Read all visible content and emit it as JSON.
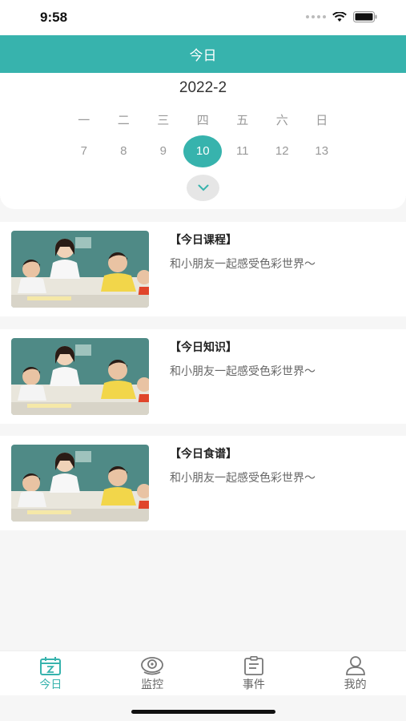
{
  "status_bar": {
    "time": "9:58"
  },
  "nav": {
    "title": "今日"
  },
  "calendar": {
    "month_title": "2022-2",
    "weekdays": [
      "一",
      "二",
      "三",
      "四",
      "五",
      "六",
      "日"
    ],
    "dates": [
      "7",
      "8",
      "9",
      "10",
      "11",
      "12",
      "13"
    ],
    "selected_date": "10"
  },
  "cards": [
    {
      "title": "【今日课程】",
      "desc": "和小朋友一起感受色彩世界～"
    },
    {
      "title": "【今日知识】",
      "desc": "和小朋友一起感受色彩世界～"
    },
    {
      "title": "【今日食谱】",
      "desc": "和小朋友一起感受色彩世界～"
    }
  ],
  "tabbar": {
    "items": [
      {
        "label": "今日",
        "icon": "calendar-icon",
        "active": true
      },
      {
        "label": "监控",
        "icon": "camera-icon",
        "active": false
      },
      {
        "label": "事件",
        "icon": "clipboard-icon",
        "active": false
      },
      {
        "label": "我的",
        "icon": "user-icon",
        "active": false
      }
    ]
  },
  "colors": {
    "accent": "#37b3ad",
    "inactive": "#666666"
  }
}
